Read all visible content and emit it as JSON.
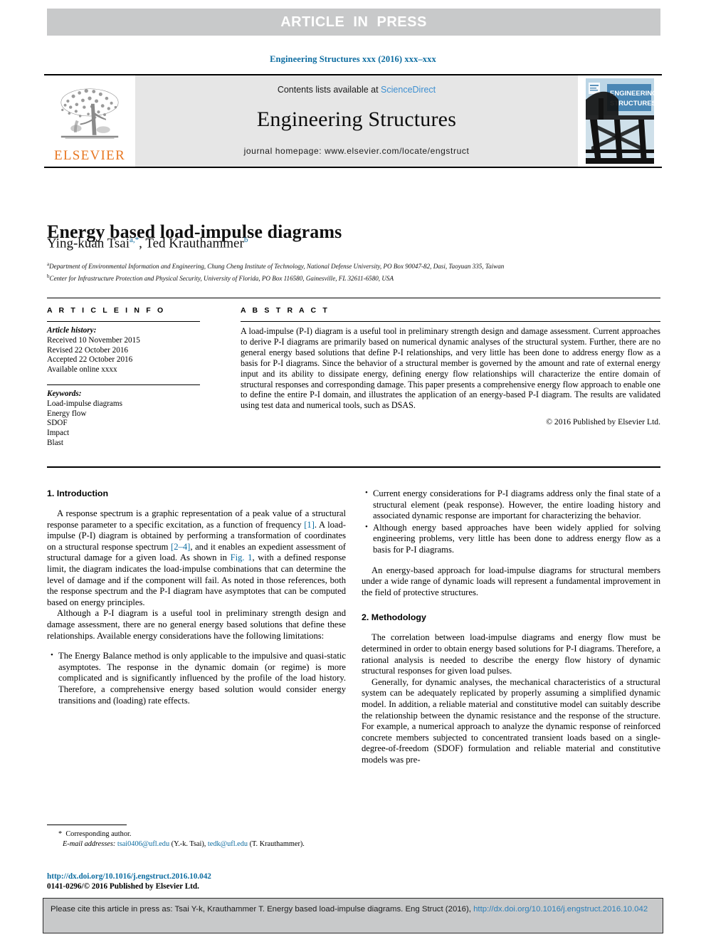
{
  "banner": {
    "text": "ARTICLE  IN  PRESS"
  },
  "running_head": "Engineering Structures xxx (2016) xxx–xxx",
  "masthead": {
    "publisher_wordmark": "ELSEVIER",
    "contents_prefix": "Contents lists available at ",
    "contents_link": "ScienceDirect",
    "journal_title": "Engineering Structures",
    "homepage": "journal homepage: www.elsevier.com/locate/engstruct",
    "cover_line1": "ENGINEERING",
    "cover_line2": "STRUCTURES"
  },
  "article": {
    "title": "Energy based load-impulse diagrams",
    "authors": [
      {
        "name": "Ying-kuan Tsai",
        "marks": "a,*"
      },
      {
        "name": "Ted Krauthammer",
        "marks": "b"
      }
    ],
    "affiliations": [
      {
        "mark": "a",
        "text": "Department of Environmental Information and Engineering, Chung Cheng Institute of Technology, National Defense University, PO Box 90047-82, Dasi, Taoyuan 335, Taiwan"
      },
      {
        "mark": "b",
        "text": "Center for Infrastructure Protection and Physical Security, University of Florida, PO Box 116580, Gainesville, FL 32611-6580, USA"
      }
    ]
  },
  "info": {
    "heading": "A R T I C L E   I N F O",
    "history_label": "Article history:",
    "history": [
      "Received 10 November 2015",
      "Revised 22 October 2016",
      "Accepted 22 October 2016",
      "Available online xxxx"
    ],
    "keywords_label": "Keywords:",
    "keywords": [
      "Load-impulse diagrams",
      "Energy flow",
      "SDOF",
      "Impact",
      "Blast"
    ]
  },
  "abstract": {
    "heading": "A B S T R A C T",
    "text": "A load-impulse (P-I) diagram is a useful tool in preliminary strength design and damage assessment. Current approaches to derive P-I diagrams are primarily based on numerical dynamic analyses of the structural system. Further, there are no general energy based solutions that define P-I relationships, and very little has been done to address energy flow as a basis for P-I diagrams. Since the behavior of a structural member is governed by the amount and rate of external energy input and its ability to dissipate energy, defining energy flow relationships will characterize the entire domain of structural responses and corresponding damage. This paper presents a comprehensive energy flow approach to enable one to define the entire P-I domain, and illustrates the application of an energy-based P-I diagram. The results are validated using test data and numerical tools, such as DSAS.",
    "copyright": "© 2016 Published by Elsevier Ltd."
  },
  "left_column": {
    "section_heading": "1. Introduction",
    "para1_a": "A response spectrum is a graphic representation of a peak value of a structural response parameter to a specific excitation, as a function of frequency ",
    "ref1": "[1]",
    "para1_b": ". A load-impulse (P-I) diagram is obtained by performing a transformation of coordinates on a structural response spectrum ",
    "ref2": "[2–4]",
    "para1_c": ", and it enables an expedient assessment of structural damage for a given load. As shown in ",
    "figref": "Fig. 1",
    "para1_d": ", with a defined response limit, the diagram indicates the load-impulse combinations that can determine the level of damage and if the component will fail. As noted in those references, both the response spectrum and the P-I diagram have asymptotes that can be computed based on energy principles.",
    "para2": "Although a P-I diagram is a useful tool in preliminary strength design and damage assessment, there are no general energy based solutions that define these relationships. Available energy considerations have the following limitations:",
    "bullet1": "The Energy Balance method is only applicable to the impulsive and quasi-static asymptotes. The response in the dynamic domain (or regime) is more complicated and is significantly influenced by the profile of the load history. Therefore, a comprehensive energy based solution would consider energy transitions and (loading) rate effects."
  },
  "right_column": {
    "bullet2": "Current energy considerations for P-I diagrams address only the final state of a structural element (peak response). However, the entire loading history and associated dynamic response are important for characterizing the behavior.",
    "bullet3": "Although energy based approaches have been widely applied for solving engineering problems, very little has been done to address energy flow as a basis for P-I diagrams.",
    "para3": "An energy-based approach for load-impulse diagrams for structural members under a wide range of dynamic loads will represent a fundamental improvement in the field of protective structures.",
    "section_heading": "2. Methodology",
    "para4": "The correlation between load-impulse diagrams and energy flow must be determined in order to obtain energy based solutions for P-I diagrams. Therefore, a rational analysis is needed to describe the energy flow history of dynamic structural responses for given load pulses.",
    "para5": "Generally, for dynamic analyses, the mechanical characteristics of a structural system can be adequately replicated by properly assuming a simplified dynamic model. In addition, a reliable material and constitutive model can suitably describe the relationship between the dynamic resistance and the response of the structure. For example, a numerical approach to analyze the dynamic response of reinforced concrete members subjected to concentrated transient loads based on a single-degree-of-freedom (SDOF) formulation and reliable material and constitutive models was pre-"
  },
  "footnote": {
    "corresponding": "Corresponding author.",
    "email_label": "E-mail addresses:",
    "email1": "tsai0406@ufl.edu",
    "email1_owner": " (Y.-k. Tsai), ",
    "email2": "tedk@ufl.edu",
    "email2_owner": " (T. Krauthammer)."
  },
  "doi_footer": {
    "doi": "http://dx.doi.org/10.1016/j.engstruct.2016.10.042",
    "issn": "0141-0296/© 2016 Published by Elsevier Ltd."
  },
  "cite_box": {
    "text": "Please cite this article in press as: Tsai Y-k, Krauthammer T. Energy based load-impulse diagrams. Eng Struct (2016), ",
    "link": "http://dx.doi.org/10.1016/j.engstruct.2016.10.042"
  },
  "colors": {
    "banner_bg": "#c8c9ca",
    "link_blue": "#0c6ca0",
    "elsevier_orange": "#e87722",
    "masthead_bg": "#e6e6e6",
    "cover_blue": "#4a87b5"
  }
}
